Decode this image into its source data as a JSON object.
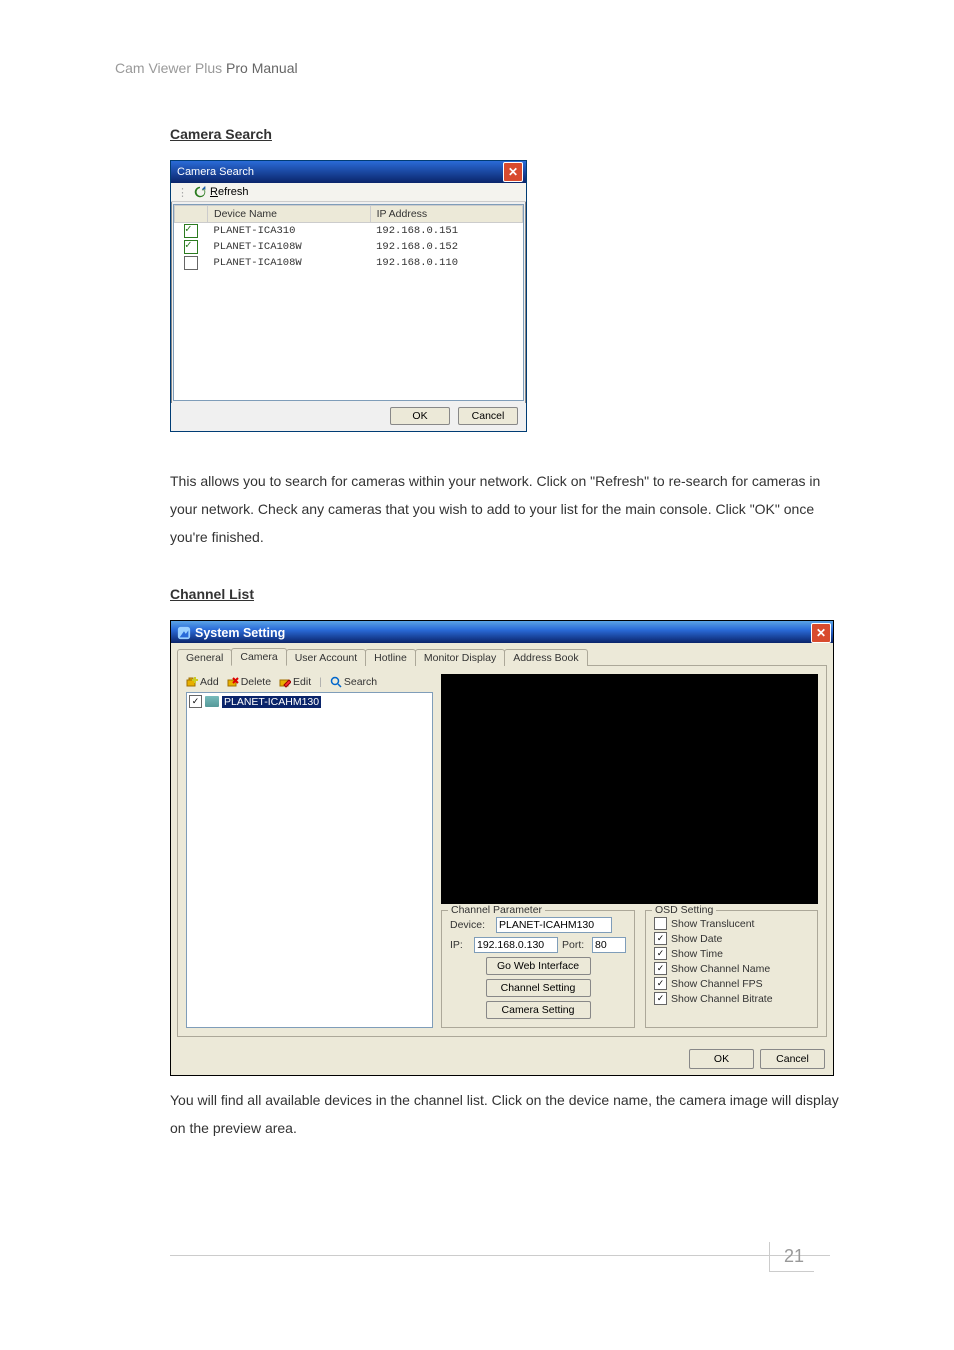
{
  "document": {
    "header": "Cam Viewer Plus",
    "manual_label": "Pro Manual",
    "page_number": "21",
    "section_camera_search": "Camera Search",
    "section_channel_list": "Channel List",
    "paragraph1": "This allows you to search for cameras within your network. Click on \"Refresh\" to re-search for cameras in your network. Check any cameras that you wish to add to your list for the main console. Click \"OK\" once you're finished.",
    "paragraph2": "You will find all available devices in the channel list. Click on the device name, the camera image will display on the preview area."
  },
  "camera_search": {
    "title": "Camera Search",
    "refresh_label": "Refresh",
    "columns": {
      "device_name": "Device Name",
      "ip_address": "IP Address"
    },
    "rows": [
      {
        "checked": true,
        "name": "PLANET-ICA310",
        "ip": "192.168.0.151"
      },
      {
        "checked": true,
        "name": "PLANET-ICA108W",
        "ip": "192.168.0.152"
      },
      {
        "checked": false,
        "name": "PLANET-ICA108W",
        "ip": "192.168.0.110"
      }
    ],
    "ok_label": "OK",
    "cancel_label": "Cancel"
  },
  "system_setting": {
    "title": "System Setting",
    "tabs": [
      "General",
      "Camera",
      "User Account",
      "Hotline",
      "Monitor Display",
      "Address Book"
    ],
    "active_tab": 1,
    "toolbar": {
      "add": "Add",
      "delete": "Delete",
      "edit": "Edit",
      "search": "Search"
    },
    "tree_item": {
      "checked": true,
      "label": "PLANET-ICAHM130"
    },
    "channel_parameter": {
      "legend": "Channel Parameter",
      "device_label": "Device:",
      "device_value": "PLANET-ICAHM130",
      "ip_label": "IP:",
      "ip_value": "192.168.0.130",
      "port_label": "Port:",
      "port_value": "80",
      "go_web_label": "Go Web Interface",
      "channel_setting_label": "Channel Setting",
      "camera_setting_label": "Camera Setting"
    },
    "osd": {
      "legend": "OSD Setting",
      "items": [
        {
          "label": "Show Translucent",
          "checked": false
        },
        {
          "label": "Show Date",
          "checked": true
        },
        {
          "label": "Show Time",
          "checked": true
        },
        {
          "label": "Show Channel Name",
          "checked": true
        },
        {
          "label": "Show Channel FPS",
          "checked": true
        },
        {
          "label": "Show Channel Bitrate",
          "checked": true
        }
      ]
    },
    "ok_label": "OK",
    "cancel_label": "Cancel"
  }
}
